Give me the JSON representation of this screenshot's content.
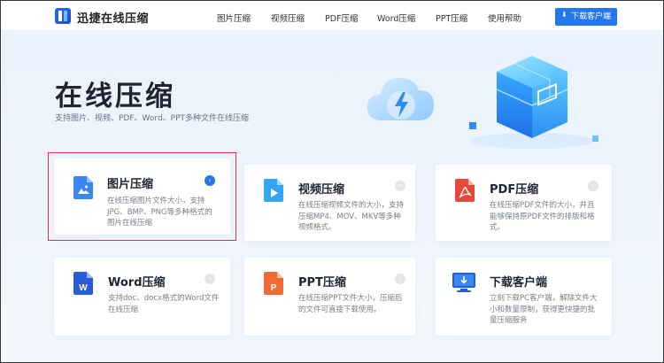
{
  "header": {
    "brand": "迅捷在线压缩",
    "nav": [
      "图片压缩",
      "视频压缩",
      "PDF压缩",
      "Word压缩",
      "PPT压缩",
      "使用帮助"
    ],
    "download_button": "下载客户端"
  },
  "hero": {
    "title": "在线压缩",
    "subtitle": "支持图片、视频、PDF、Word、PPT多种文件在线压缩"
  },
  "cards": [
    {
      "title": "图片压缩",
      "desc": "在线压缩图片文件大小，支持JPG、BMP、PNG等多种格式的图片在线压缩",
      "icon": "image-file-icon",
      "active": true
    },
    {
      "title": "视频压缩",
      "desc": "在线压缩视频文件的大小，支持压缩MP4、MOV、MKV等多种视频格式。",
      "icon": "video-file-icon",
      "active": false
    },
    {
      "title": "PDF压缩",
      "desc": "在线压缩PDF文件的大小，并且能够保持原PDF文件的排版和格式。",
      "icon": "pdf-file-icon",
      "active": false
    },
    {
      "title": "Word压缩",
      "desc": "支持doc、docx格式的Word文件在线压缩",
      "icon": "word-file-icon",
      "active": false
    },
    {
      "title": "PPT压缩",
      "desc": "在线压缩PPT文件大小，压缩后的文件可直接下载使用。",
      "icon": "ppt-file-icon",
      "active": false
    },
    {
      "title": "下载客户端",
      "desc": "立刻下载PC客户端，解除文件大小和数量限制，获得更快捷的批量压缩服务",
      "icon": "monitor-download-icon",
      "active": false
    }
  ],
  "colors": {
    "accent": "#2475ee",
    "highlight_border": "#d33a3a",
    "pdf": "#e8473e",
    "word": "#2a5bd7",
    "ppt": "#f06a35"
  }
}
